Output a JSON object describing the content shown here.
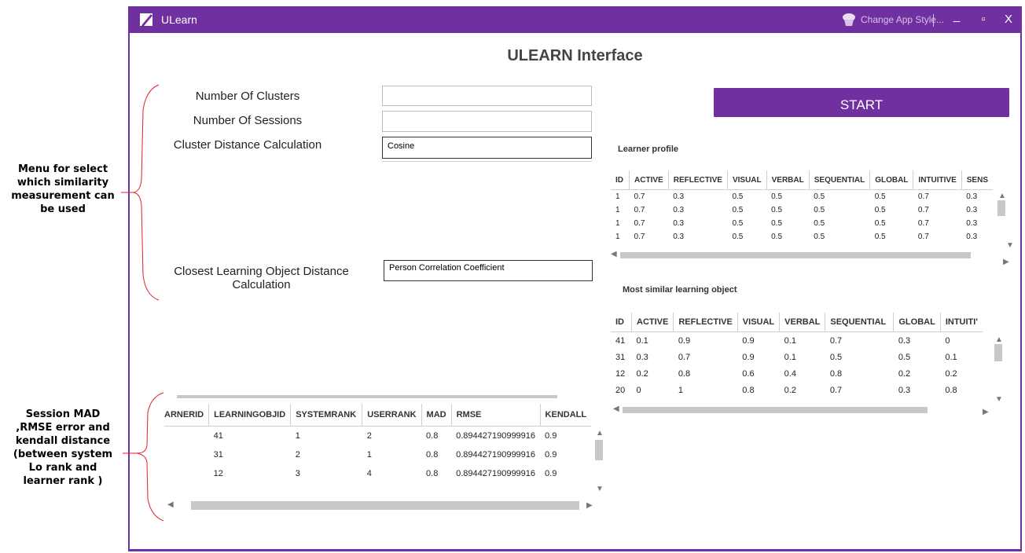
{
  "annotations": {
    "menu_note": [
      "Menu for select",
      "which similarity",
      "measurement can",
      "be used"
    ],
    "session_note": [
      "Session MAD",
      ",RMSE error and",
      "kendall distance",
      "(between system",
      "Lo rank and",
      "learner rank )"
    ]
  },
  "window": {
    "app_title": "ULearn",
    "change_style": "Change App Style...",
    "minimize": "_",
    "maximize": "▫",
    "close": "X"
  },
  "main_title": "ULEARN Interface",
  "form": {
    "clusters_label": "Number Of Clusters",
    "clusters_value": "",
    "sessions_label": "Number Of Sessions",
    "sessions_value": "",
    "cluster_distance_label": "Cluster Distance Calculation",
    "cluster_distance_value": "Cosine",
    "lo_distance_label": "Closest Learning Object Distance Calculation",
    "lo_distance_value": "Person Correlation Coefficient"
  },
  "start_label": "START",
  "learner_profile": {
    "title": "Learner profile",
    "columns": [
      "ID",
      "ACTIVE",
      "REFLECTIVE",
      "VISUAL",
      "VERBAL",
      "SEQUENTIAL",
      "GLOBAL",
      "INTUITIVE",
      "SENS"
    ],
    "rows": [
      [
        "1",
        "0.7",
        "0.3",
        "0.5",
        "0.5",
        "0.5",
        "0.5",
        "0.7",
        "0.3"
      ],
      [
        "1",
        "0.7",
        "0.3",
        "0.5",
        "0.5",
        "0.5",
        "0.5",
        "0.7",
        "0.3"
      ],
      [
        "1",
        "0.7",
        "0.3",
        "0.5",
        "0.5",
        "0.5",
        "0.5",
        "0.7",
        "0.3"
      ],
      [
        "1",
        "0.7",
        "0.3",
        "0.5",
        "0.5",
        "0.5",
        "0.5",
        "0.7",
        "0.3"
      ]
    ]
  },
  "similar_lo": {
    "title": "Most similar learning object",
    "columns": [
      "ID",
      "ACTIVE",
      "REFLECTIVE",
      "VISUAL",
      "VERBAL",
      "SEQUENTIAL",
      "GLOBAL",
      "INTUITI'"
    ],
    "rows": [
      [
        "41",
        "0.1",
        "0.9",
        "0.9",
        "0.1",
        "0.7",
        "0.3",
        "0"
      ],
      [
        "31",
        "0.3",
        "0.7",
        "0.9",
        "0.1",
        "0.5",
        "0.5",
        "0.1"
      ],
      [
        "12",
        "0.2",
        "0.8",
        "0.6",
        "0.4",
        "0.8",
        "0.2",
        "0.2"
      ],
      [
        "20",
        "0",
        "1",
        "0.8",
        "0.2",
        "0.7",
        "0.3",
        "0.8"
      ]
    ]
  },
  "session_table": {
    "columns": [
      "ARNERID",
      "LEARNINGOBJID",
      "SYSTEMRANK",
      "USERRANK",
      "MAD",
      "RMSE",
      "KENDALL"
    ],
    "rows": [
      [
        "",
        "41",
        "1",
        "2",
        "0.8",
        "0.894427190999916",
        "0.9"
      ],
      [
        "",
        "31",
        "2",
        "1",
        "0.8",
        "0.894427190999916",
        "0.9"
      ],
      [
        "",
        "12",
        "3",
        "4",
        "0.8",
        "0.894427190999916",
        "0.9"
      ]
    ]
  },
  "colors": {
    "accent": "#7030a0",
    "annotation_brace": "#e0202a"
  }
}
